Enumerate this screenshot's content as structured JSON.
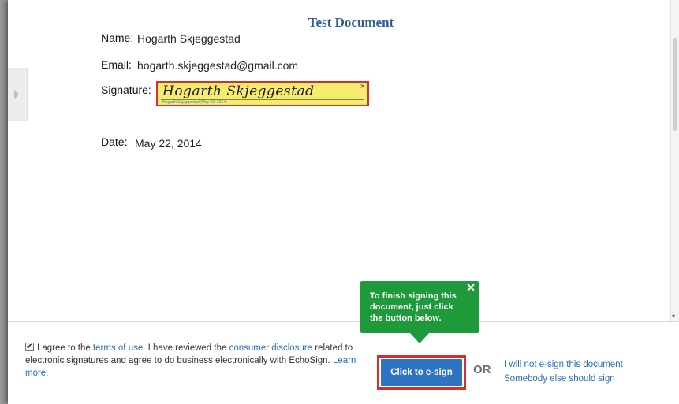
{
  "document": {
    "title": "Test Document",
    "name_label": "Name:",
    "name_value": "Hogarth Skjeggestad",
    "email_label": "Email:",
    "email_value": "hogarth.skjeggestad@gmail.com",
    "signature_label": "Signature:",
    "signature_handwritten": "Hogarth Skjeggestad",
    "signature_meta": "Hogarth Skjeggestad (May 22, 2014)",
    "signature_close": "×",
    "date_label": "Date:",
    "date_value": "May 22, 2014"
  },
  "tooltip": {
    "text": "To finish signing this document, just click the button below.",
    "close": "✕",
    "color": "#1f9a3b"
  },
  "footer": {
    "agree_prefix": "I agree to the ",
    "terms_link": "terms of use",
    "agree_mid": ". I have reviewed the ",
    "disclosure_link": "consumer disclosure",
    "agree_rest": " related to electronic signatures and agree to do business electronically with EchoSign.",
    "learn_more": "Learn more.",
    "agree_checked": true,
    "esign_button": "Click to e-sign",
    "or_text": "OR",
    "decline_link": "I will not e-sign this document",
    "delegate_link": "Somebody else should sign"
  },
  "icons": {
    "expand_panel": "chevron-right-icon",
    "checkbox": "checkmark-icon"
  },
  "colors": {
    "accent_blue": "#2e74c3",
    "highlight_red": "#d3302b",
    "signature_field": "#f8ec6f",
    "title_blue": "#2f5d93"
  }
}
